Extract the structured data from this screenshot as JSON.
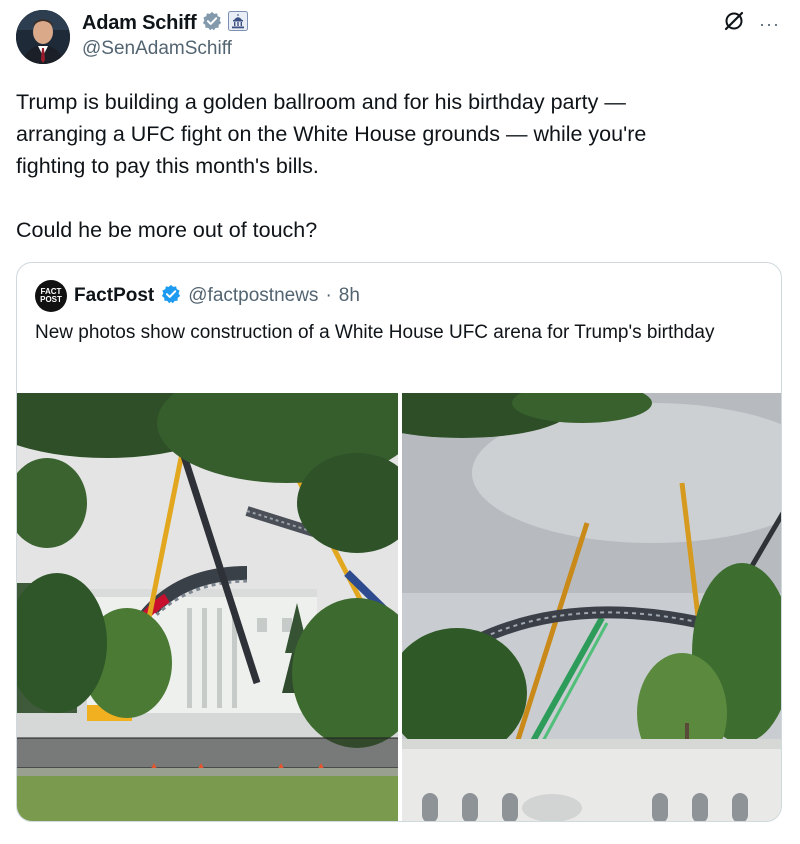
{
  "author": {
    "display_name": "Adam Schiff",
    "handle": "@SenAdamSchiff"
  },
  "post": {
    "paragraph_1": "Trump is building a golden ballroom and for his birthday party —\narranging a UFC fight on the White House grounds — while you're\nfighting to pay this month's bills.",
    "paragraph_2": "Could he be more out of touch?"
  },
  "quote": {
    "logo_line_1": "FACT",
    "logo_line_2": "POST",
    "display_name": "FactPost",
    "handle": "@factpostnews",
    "separator": "·",
    "time": "8h",
    "text": "New photos show construction of a White House UFC arena for Trump's birthday"
  },
  "icons": {
    "verified": "verified-badge-icon",
    "government": "government-building-icon",
    "grok": "grok-icon",
    "more": "more-options-icon"
  },
  "colors": {
    "verified_blue": "#1d9bf0",
    "text_primary": "#0f1419",
    "text_secondary": "#536471",
    "border": "#cfd9de"
  },
  "more_label": "···"
}
